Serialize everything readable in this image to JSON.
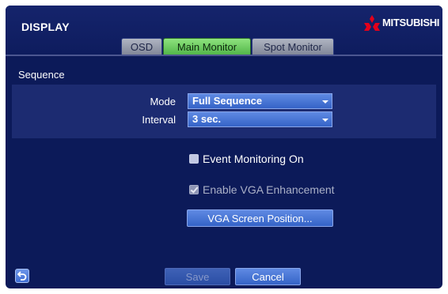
{
  "window": {
    "title": "DISPLAY"
  },
  "brand": {
    "name": "MITSUBISHI",
    "icon": "mitsubishi-diamonds-icon",
    "color": "#e3001b"
  },
  "tabs": [
    {
      "label": "OSD",
      "active": false
    },
    {
      "label": "Main Monitor",
      "active": true
    },
    {
      "label": "Spot Monitor",
      "active": false
    }
  ],
  "sequence": {
    "title": "Sequence",
    "mode": {
      "label": "Mode",
      "value": "Full Sequence"
    },
    "interval": {
      "label": "Interval",
      "value": "3 sec."
    }
  },
  "options": {
    "event_monitoring": {
      "label": "Event Monitoring On",
      "checked": false,
      "enabled": true
    },
    "vga_enhancement": {
      "label": "Enable VGA Enhancement",
      "checked": true,
      "enabled": false
    }
  },
  "buttons": {
    "vga_position": "VGA Screen Position...",
    "save": "Save",
    "cancel": "Cancel",
    "back_icon": "back-arrow-icon"
  },
  "colors": {
    "background": "#0c1a59",
    "active_tab": "#5fc454",
    "control": "#4a77d6"
  }
}
